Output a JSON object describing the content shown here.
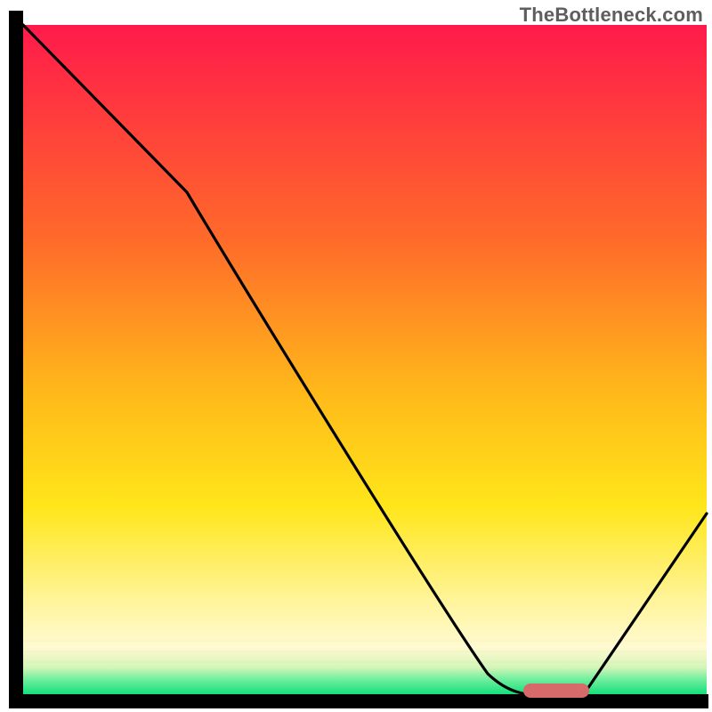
{
  "watermark": "TheBottleneck.com",
  "colors": {
    "red": "#ff1a4b",
    "orange": "#ff9a1f",
    "yellow": "#ffe61a",
    "pale_yellow": "#fff7a6",
    "green": "#14e07a",
    "axis": "#000000",
    "curve": "#000000",
    "marker": "#d66a6a"
  },
  "chart_data": {
    "type": "line",
    "title": "",
    "xlabel": "",
    "ylabel": "",
    "xlim": [
      0,
      100
    ],
    "ylim": [
      0,
      100
    ],
    "x": [
      0,
      24,
      68,
      74,
      82,
      100
    ],
    "y": [
      100,
      75,
      3,
      0,
      0,
      27
    ],
    "marker": {
      "x_start": 74,
      "x_end": 82,
      "y": 0
    },
    "bands": [
      {
        "y0": 100,
        "y1": 30,
        "color_top": "#ff1a4b",
        "color_bottom": "#ffe61a"
      },
      {
        "y0": 30,
        "y1": 14,
        "color_top": "#ffe61a",
        "color_bottom": "#fff49a"
      },
      {
        "y0": 14,
        "y1": 6,
        "color_top": "#fff49a",
        "color_bottom": "#fffad2"
      },
      {
        "y0": 6,
        "y1": 3,
        "color_top": "#fffad2",
        "color_bottom": "#c9f5b8"
      },
      {
        "y0": 3,
        "y1": 0,
        "color_top": "#14e07a",
        "color_bottom": "#14e07a"
      }
    ]
  }
}
